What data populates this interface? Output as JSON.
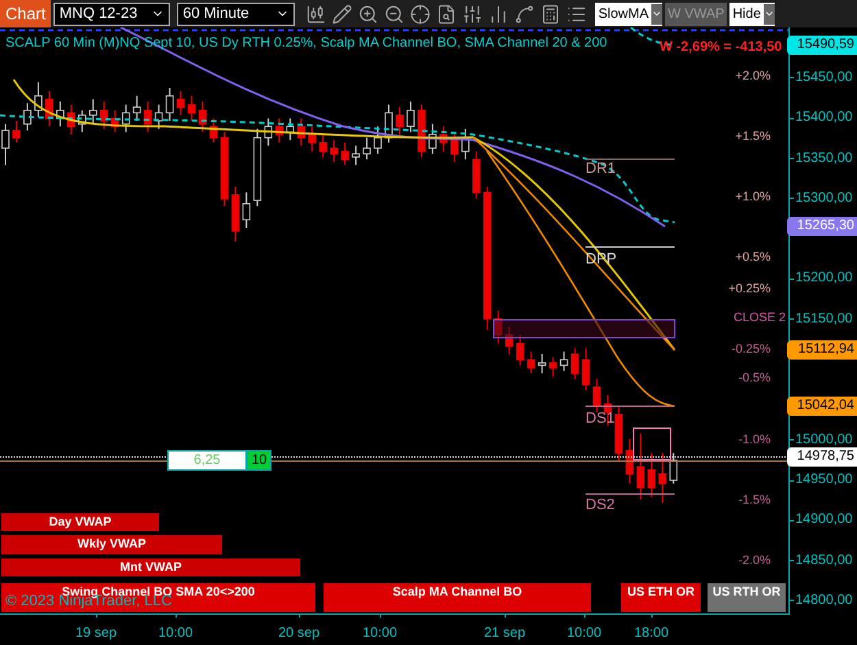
{
  "toolbar": {
    "brand": "Chart",
    "instrument": "MNQ 12-23",
    "interval": "60 Minute",
    "indicator_select": "SlowMA",
    "vwap_button": {
      "label": "W VWAP",
      "disabled": true
    },
    "hide_select": "Hide"
  },
  "chart": {
    "title": "SCALP 60 Min (M)NQ Sept 10, US Dy RTH 0.25%, Scalp MA Channel BO, SMA Channel 20 & 200",
    "pnl": "W -2,69% = -413,50",
    "chart_data": {
      "type": "candlestick",
      "categories": [
        null,
        null,
        null,
        null,
        null,
        null,
        null,
        null,
        null,
        null,
        null,
        null,
        null,
        null,
        null,
        null,
        null,
        null,
        null,
        null,
        null,
        null,
        null,
        null,
        null,
        null,
        null,
        null,
        null,
        null,
        null,
        null,
        null,
        null,
        null,
        null,
        null,
        null,
        null,
        null,
        null,
        null,
        null,
        null,
        null,
        null,
        null,
        null,
        null,
        null,
        null,
        null,
        null,
        null,
        null,
        null,
        null,
        null,
        null,
        null,
        null,
        null,
        null,
        null,
        null,
        null,
        null,
        null,
        null,
        null,
        null,
        null
      ],
      "ylim": [
        14784.5,
        15513.1
      ],
      "yticks": [
        {
          "value": 15450,
          "label": "15450,00"
        },
        {
          "value": 15400,
          "label": "15400,00"
        },
        {
          "value": 15350,
          "label": "15350,00"
        },
        {
          "value": 15300,
          "label": "15300,00"
        },
        {
          "value": 15200,
          "label": "15200,00"
        },
        {
          "value": 15150,
          "label": "15150,00"
        },
        {
          "value": 15000,
          "label": "15000,00"
        },
        {
          "value": 14950,
          "label": "14950,00"
        },
        {
          "value": 14900,
          "label": "14900,00"
        },
        {
          "value": 14850,
          "label": "14850,00"
        },
        {
          "value": 14800,
          "label": "14800,00"
        }
      ],
      "ohlc": [
        [
          15363,
          15393,
          15342,
          15385
        ],
        [
          15385,
          15397,
          15370,
          15376
        ],
        [
          15393,
          15419,
          15385,
          15410
        ],
        [
          15410,
          15445,
          15402,
          15428
        ],
        [
          15424,
          15434,
          15390,
          15400
        ],
        [
          15400,
          15421,
          15390,
          15410
        ],
        [
          15407,
          15417,
          15380,
          15390
        ],
        [
          15393,
          15410,
          15383,
          15404
        ],
        [
          15404,
          15424,
          15393,
          15410
        ],
        [
          15410,
          15421,
          15387,
          15397
        ],
        [
          15400,
          15410,
          15383,
          15390
        ],
        [
          15393,
          15417,
          15383,
          15407
        ],
        [
          15407,
          15428,
          15397,
          15414
        ],
        [
          15410,
          15421,
          15383,
          15393
        ],
        [
          15397,
          15417,
          15387,
          15407
        ],
        [
          15407,
          15438,
          15397,
          15428
        ],
        [
          15424,
          15434,
          15404,
          15414
        ],
        [
          15417,
          15428,
          15397,
          15407
        ],
        [
          15410,
          15421,
          15383,
          15393
        ],
        [
          15390,
          15400,
          15370,
          15376
        ],
        [
          15376,
          15383,
          15291,
          15300
        ],
        [
          15305,
          15315,
          15247,
          15260
        ],
        [
          15274,
          15308,
          15264,
          15294
        ],
        [
          15298,
          15387,
          15291,
          15376
        ],
        [
          15376,
          15400,
          15366,
          15390
        ],
        [
          15390,
          15400,
          15370,
          15380
        ],
        [
          15383,
          15400,
          15373,
          15390
        ],
        [
          15390,
          15400,
          15366,
          15376
        ],
        [
          15380,
          15390,
          15359,
          15370
        ],
        [
          15370,
          15380,
          15352,
          15359
        ],
        [
          15363,
          15373,
          15346,
          15356
        ],
        [
          15359,
          15370,
          15342,
          15349
        ],
        [
          15352,
          15366,
          15342,
          15356
        ],
        [
          15356,
          15376,
          15349,
          15363
        ],
        [
          15363,
          15390,
          15356,
          15376
        ],
        [
          15376,
          15417,
          15370,
          15407
        ],
        [
          15404,
          15414,
          15380,
          15390
        ],
        [
          15390,
          15421,
          15383,
          15410
        ],
        [
          15410,
          15417,
          15352,
          15359
        ],
        [
          15363,
          15393,
          15356,
          15380
        ],
        [
          15380,
          15390,
          15359,
          15370
        ],
        [
          15373,
          15383,
          15346,
          15356
        ],
        [
          15359,
          15387,
          15349,
          15376
        ],
        [
          15349,
          15359,
          15300,
          15308
        ],
        [
          15308,
          15315,
          15137,
          15151
        ],
        [
          15151,
          15161,
          15120,
          15131
        ],
        [
          15131,
          15141,
          15107,
          15117
        ],
        [
          15120,
          15131,
          15093,
          15100
        ],
        [
          15100,
          15110,
          15083,
          15090
        ],
        [
          15093,
          15107,
          15083,
          15096
        ],
        [
          15096,
          15103,
          15079,
          15090
        ],
        [
          15093,
          15110,
          15086,
          15100
        ],
        [
          15107,
          15114,
          15076,
          15083
        ],
        [
          15100,
          15114,
          15062,
          15069
        ],
        [
          15066,
          15076,
          15035,
          15042
        ],
        [
          15045,
          15056,
          15018,
          15035
        ],
        [
          15032,
          15042,
          14974,
          14984
        ],
        [
          14987,
          15001,
          14946,
          14958
        ],
        [
          14967,
          15008,
          14926,
          14941
        ],
        [
          14963,
          14984,
          14929,
          14941
        ],
        [
          14958,
          14984,
          14922,
          14946
        ],
        [
          14950,
          14984,
          14946,
          14975
        ],
        null,
        null,
        null,
        null,
        null,
        null,
        null,
        null,
        null,
        null
      ]
    },
    "percent_labels": [
      "+2.0%",
      "+1.5%",
      "+1.0%",
      "+0.5%",
      "+0.25%",
      "-0.25%",
      "-0.5%",
      "-1.0%",
      "-1.5%",
      "-2.0%"
    ],
    "close_label": "CLOSE 2",
    "level_labels": [
      "DR1",
      "DPP",
      "DS1",
      "DS2"
    ],
    "order_entry": {
      "price": "6,25",
      "quantity": "10"
    },
    "indicator_bars": [
      {
        "label": "Day VWAP",
        "color": "#cc0000"
      },
      {
        "label": "Wkly VWAP",
        "color": "#cc0000"
      },
      {
        "label": "Mnt VWAP",
        "color": "#cc0000"
      },
      {
        "label": "Swing Channel BO  SMA 20<>200",
        "color": "#dd0000"
      },
      {
        "label": "Scalp MA Channel BO",
        "color": "#dd0000"
      },
      {
        "label": "US ETH OR",
        "color": "#dd0000"
      },
      {
        "label": "US RTH OR",
        "color": "#707070"
      }
    ],
    "copyright": "© 2023 NinjaTrader, LLC"
  },
  "price_axis": {
    "tags": [
      {
        "text": "15490,59",
        "color": "#00e5e5"
      },
      {
        "text": "15265,30",
        "color": "#8878ee"
      },
      {
        "text": "15112,94",
        "color": "#ff9900"
      },
      {
        "text": "15042,04",
        "color": "#ff9900"
      },
      {
        "text": "14978,75",
        "color": "#ffffff"
      }
    ]
  },
  "time_axis": {
    "labels": [
      "19 sep",
      "10:00",
      "20 sep",
      "10:00",
      "21 sep",
      "10:00",
      "18:00"
    ]
  }
}
